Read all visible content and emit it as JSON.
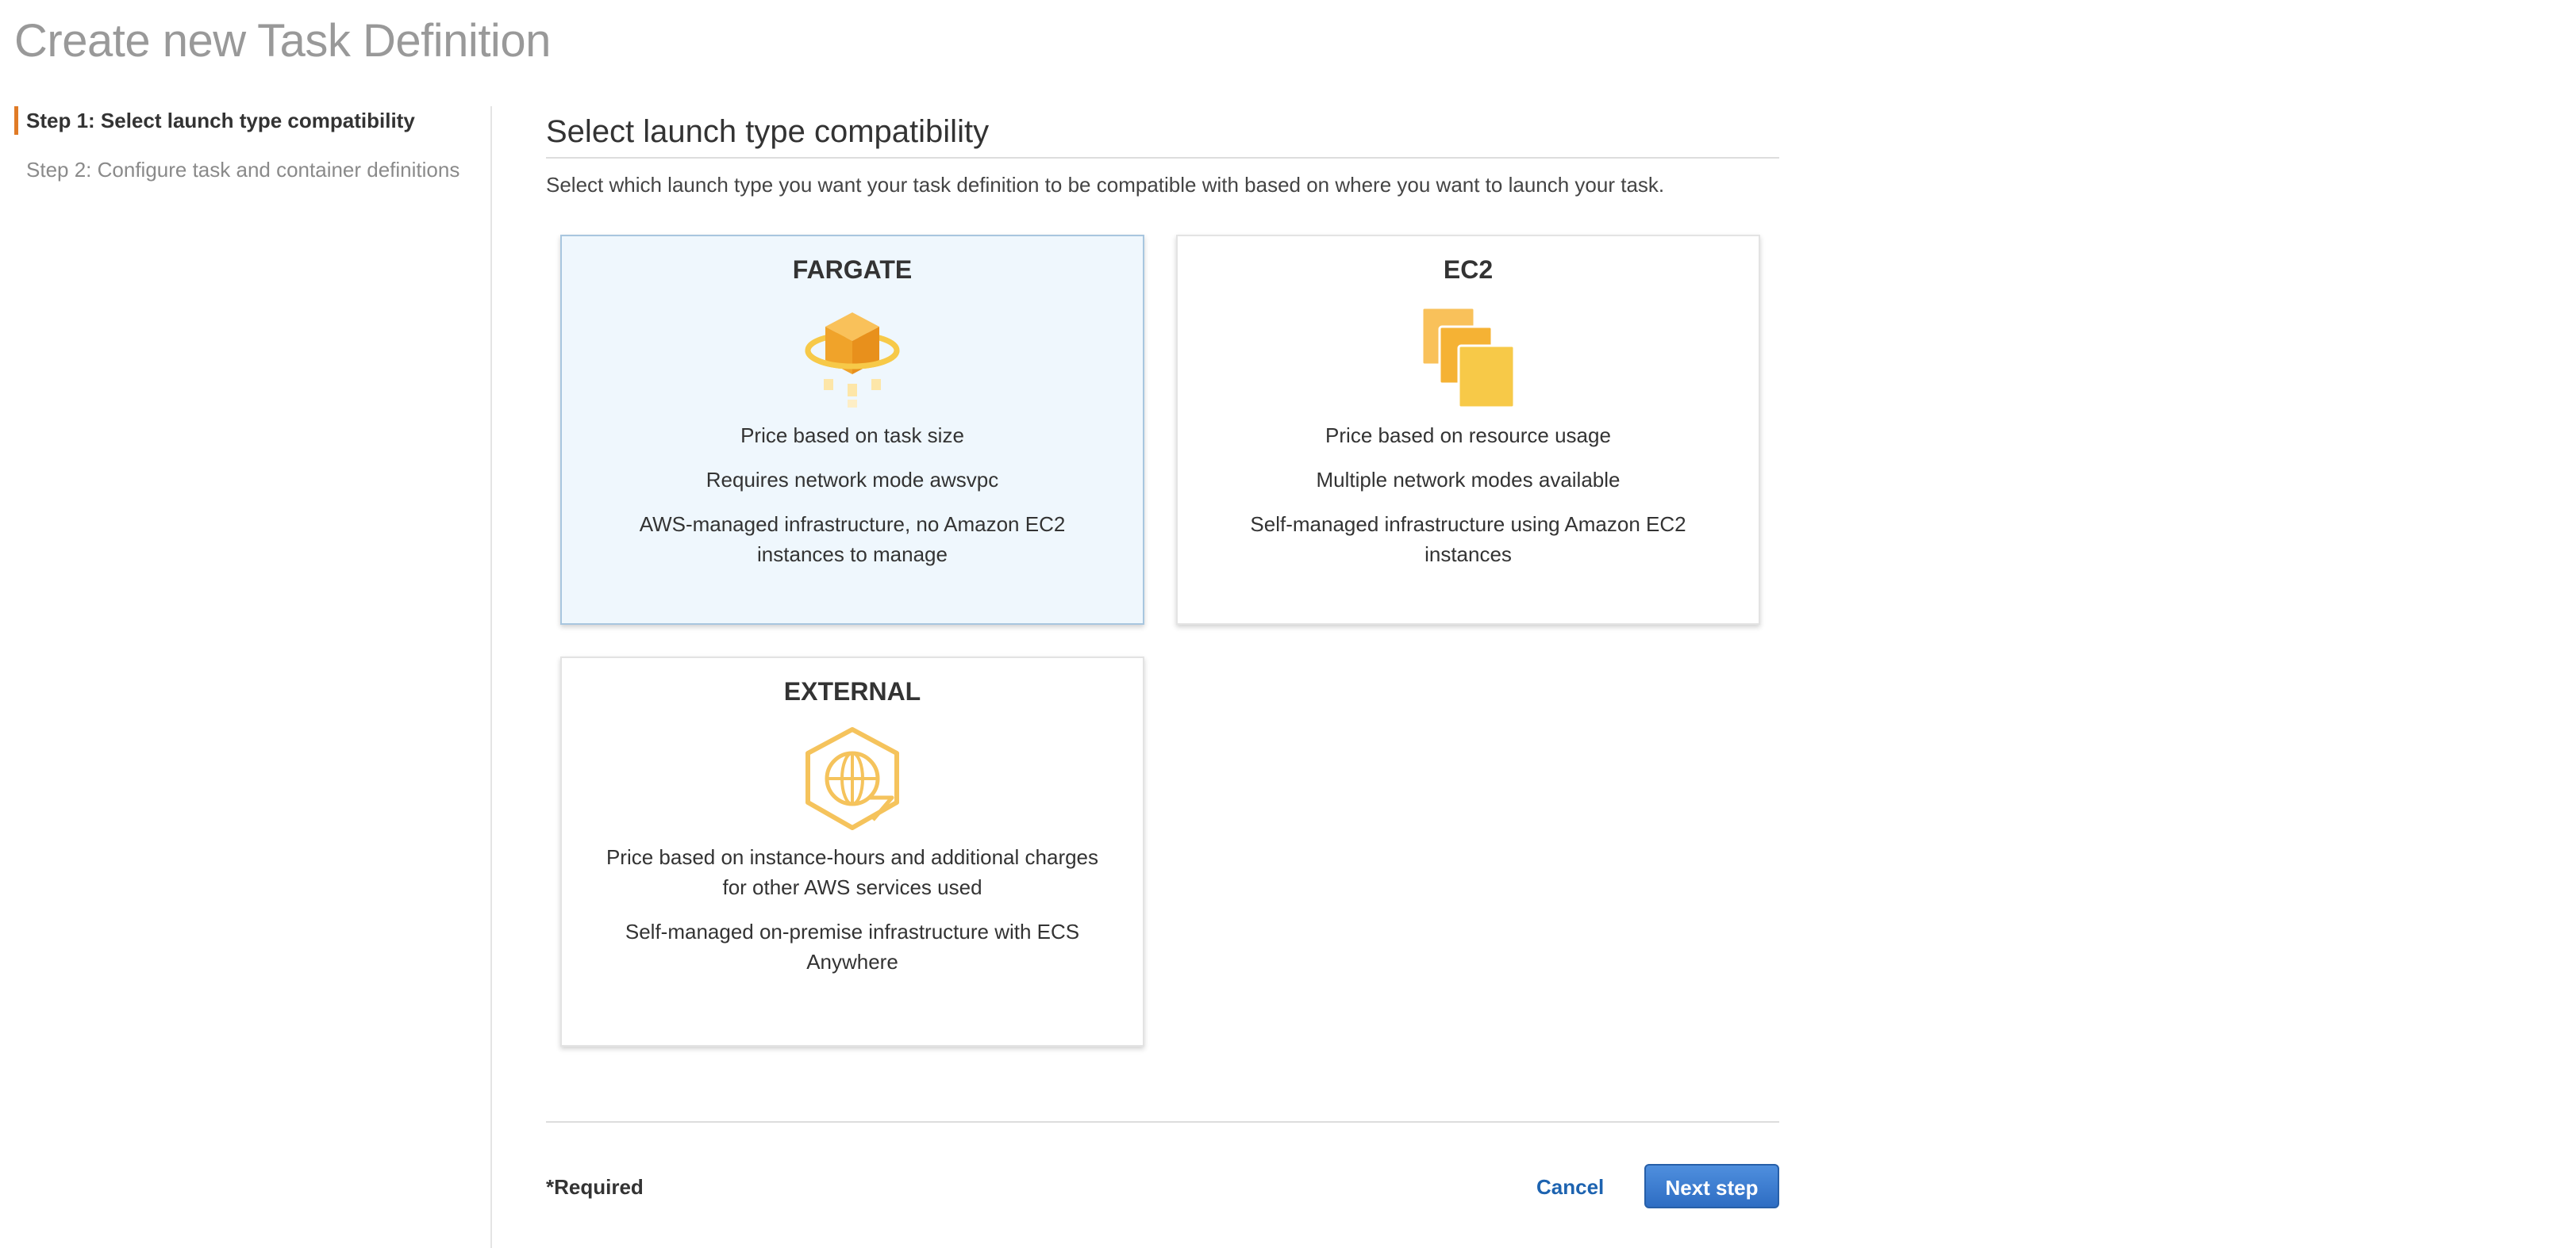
{
  "page": {
    "title": "Create new Task Definition"
  },
  "sidebar": {
    "steps": [
      {
        "label": "Step 1: Select launch type compatibility",
        "active": true
      },
      {
        "label": "Step 2: Configure task and container definitions",
        "active": false
      }
    ]
  },
  "main": {
    "section_title": "Select launch type compatibility",
    "description": "Select which launch type you want your task definition to be compatible with based on where you want to launch your task.",
    "cards": [
      {
        "title": "FARGATE",
        "icon": "fargate-cube-icon",
        "selected": true,
        "lines": [
          "Price based on task size",
          "Requires network mode awsvpc",
          "AWS-managed infrastructure, no Amazon EC2 instances to manage"
        ]
      },
      {
        "title": "EC2",
        "icon": "ec2-instances-icon",
        "selected": false,
        "lines": [
          "Price based on resource usage",
          "Multiple network modes available",
          "Self-managed infrastructure using Amazon EC2 instances"
        ]
      },
      {
        "title": "EXTERNAL",
        "icon": "ecs-anywhere-globe-icon",
        "selected": false,
        "lines": [
          "Price based on instance-hours and additional charges for other AWS services used",
          "Self-managed on-premise infrastructure with ECS Anywhere"
        ]
      }
    ]
  },
  "footer": {
    "required_note": "*Required",
    "cancel_label": "Cancel",
    "next_label": "Next step"
  },
  "colors": {
    "accent_orange": "#e07b26",
    "link_blue": "#1d63b0",
    "primary_button": "#2e6dc3",
    "selected_card_bg": "#eff7fd",
    "icon_orange": "#f5a623",
    "icon_yellow": "#f7c948"
  }
}
